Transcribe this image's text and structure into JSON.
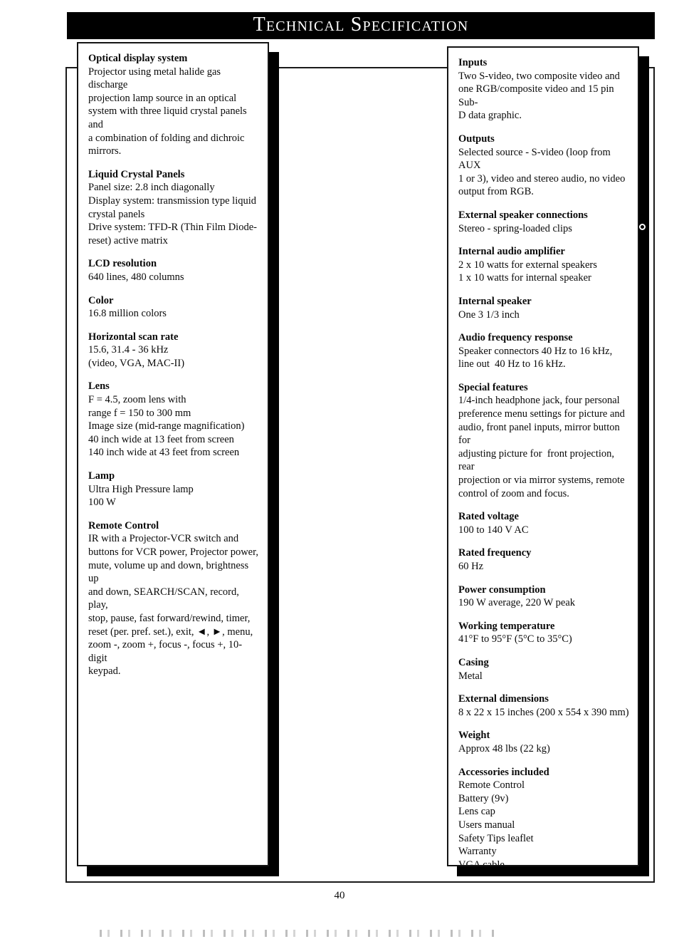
{
  "header": {
    "title": "Technical Specification"
  },
  "left_column": {
    "groups": [
      {
        "heading": "Optical display system",
        "lines": [
          "Projector using metal halide gas discharge",
          "projection lamp source in an optical",
          "system with three liquid crystal panels and",
          "a combination of folding and dichroic",
          "mirrors."
        ]
      },
      {
        "heading": "Liquid Crystal Panels",
        "lines": [
          "Panel size: 2.8 inch diagonally",
          "Display system: transmission type liquid",
          "crystal panels",
          "Drive system: TFD-R (Thin Film Diode-",
          "reset) active matrix"
        ]
      },
      {
        "heading": "LCD resolution",
        "lines": [
          "640 lines, 480 columns"
        ]
      },
      {
        "heading": "Color",
        "lines": [
          "16.8 million colors"
        ]
      },
      {
        "heading": "Horizontal scan rate",
        "lines": [
          "15.6, 31.4 - 36 kHz",
          "(video, VGA, MAC-II)"
        ]
      },
      {
        "heading": "Lens",
        "lines": [
          "F = 4.5, zoom lens with",
          "range f = 150 to 300 mm",
          "Image size (mid-range magnification)",
          "40 inch wide at 13 feet from screen",
          "140 inch wide at 43 feet from screen"
        ]
      },
      {
        "heading": "Lamp",
        "lines": [
          "Ultra High Pressure lamp",
          "100 W"
        ]
      },
      {
        "heading": "Remote Control",
        "lines": [
          "IR with a Projector-VCR switch and",
          "buttons for VCR power, Projector power,",
          "mute, volume up and down, brightness up",
          "and down, SEARCH/SCAN, record, play,",
          "stop, pause, fast forward/rewind, timer,",
          "reset (per. pref. set.), exit, ◄, ►, menu,",
          "zoom -, zoom +, focus -, focus +, 10-digit",
          "keypad."
        ]
      }
    ]
  },
  "right_column": {
    "groups": [
      {
        "heading": "Inputs",
        "lines": [
          "Two S-video, two composite video and",
          "one RGB/composite video and 15 pin Sub-",
          "D data graphic."
        ]
      },
      {
        "heading": "Outputs",
        "lines": [
          "Selected source - S-video (loop from AUX",
          "1 or 3), video and stereo audio, no video",
          "output from RGB."
        ]
      },
      {
        "heading": "External speaker connections",
        "lines": [
          "Stereo - spring-loaded clips"
        ]
      },
      {
        "heading": "Internal audio amplifier",
        "lines": [
          "2 x 10 watts for external speakers",
          "1 x 10 watts for internal speaker"
        ]
      },
      {
        "heading": "Internal speaker",
        "lines": [
          "One 3 1/3 inch"
        ]
      },
      {
        "heading": "Audio frequency response",
        "lines": [
          "Speaker connectors 40 Hz to 16 kHz,",
          "line out  40 Hz to 16 kHz."
        ]
      },
      {
        "heading": "Special features",
        "lines": [
          "1/4-inch headphone jack, four personal",
          "preference menu settings for picture and",
          "audio, front panel inputs, mirror button for",
          "adjusting picture for  front projection, rear",
          "projection or via mirror systems, remote",
          "control of zoom and focus."
        ]
      },
      {
        "heading": "Rated voltage",
        "lines": [
          "100 to 140 V AC"
        ]
      },
      {
        "heading": "Rated frequency",
        "lines": [
          "60 Hz"
        ]
      },
      {
        "heading": "Power consumption",
        "lines": [
          "190 W average, 220 W peak"
        ]
      },
      {
        "heading": "Working temperature",
        "lines": [
          "41°F to 95°F (5°C to 35°C)"
        ]
      },
      {
        "heading": "Casing",
        "lines": [
          "Metal"
        ]
      },
      {
        "heading": "External dimensions",
        "lines": [
          "8 x 22 x 15 inches (200 x 554 x 390 mm)"
        ]
      },
      {
        "heading": "Weight",
        "lines": [
          "Approx 48 lbs (22 kg)"
        ]
      },
      {
        "heading": "Accessories included",
        "lines": [
          "Remote Control",
          "Battery (9v)",
          "Lens cap",
          "Users manual",
          "Safety Tips leaflet",
          "Warranty",
          "VGA cable"
        ]
      }
    ]
  },
  "footer": {
    "page_number": "40"
  }
}
